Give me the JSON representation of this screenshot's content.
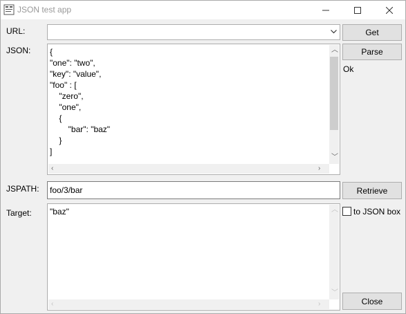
{
  "window": {
    "title": "JSON test app",
    "controls": {
      "minimize": "—",
      "maximize": "☐",
      "close": "✕"
    }
  },
  "url": {
    "label": "URL:",
    "value": "",
    "get_label": "Get"
  },
  "json": {
    "label": "JSON:",
    "lines": [
      "{",
      "\"one\": \"two\",",
      "\"key\": \"value\",",
      "\"foo\" : [",
      "    \"zero\",",
      "    \"one\",",
      "    {",
      "        \"bar\": \"baz\"",
      "    }",
      "]"
    ],
    "parse_label": "Parse",
    "status": "Ok"
  },
  "jspath": {
    "label": "JSPATH:",
    "value": "foo/3/bar",
    "retrieve_label": "Retrieve"
  },
  "target": {
    "label": "Target:",
    "value": "\"baz\"",
    "to_json_label": "to JSON box",
    "to_json_checked": false
  },
  "close_label": "Close"
}
